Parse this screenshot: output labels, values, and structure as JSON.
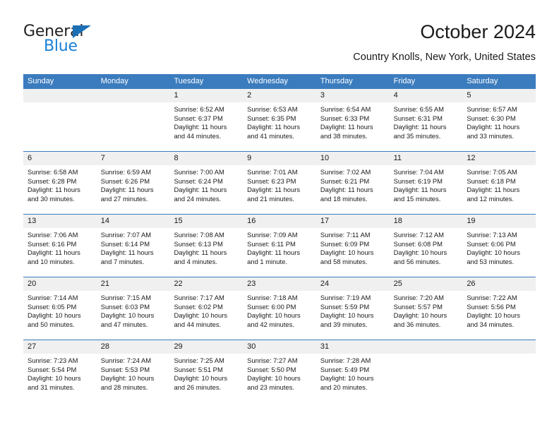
{
  "brand": {
    "name_part1": "General",
    "name_part2": "Blue",
    "accent_color": "#1a7fd4",
    "triangle_color": "#1a6fb5"
  },
  "header": {
    "title": "October 2024",
    "subtitle": "Country Knolls, New York, United States"
  },
  "calendar": {
    "header_bg": "#3b7cbe",
    "weekdays": [
      "Sunday",
      "Monday",
      "Tuesday",
      "Wednesday",
      "Thursday",
      "Friday",
      "Saturday"
    ],
    "weeks": [
      [
        {
          "day": "",
          "sunrise": "",
          "sunset": "",
          "daylight_line1": "",
          "daylight_line2": ""
        },
        {
          "day": "",
          "sunrise": "",
          "sunset": "",
          "daylight_line1": "",
          "daylight_line2": ""
        },
        {
          "day": "1",
          "sunrise": "Sunrise: 6:52 AM",
          "sunset": "Sunset: 6:37 PM",
          "daylight_line1": "Daylight: 11 hours",
          "daylight_line2": "and 44 minutes."
        },
        {
          "day": "2",
          "sunrise": "Sunrise: 6:53 AM",
          "sunset": "Sunset: 6:35 PM",
          "daylight_line1": "Daylight: 11 hours",
          "daylight_line2": "and 41 minutes."
        },
        {
          "day": "3",
          "sunrise": "Sunrise: 6:54 AM",
          "sunset": "Sunset: 6:33 PM",
          "daylight_line1": "Daylight: 11 hours",
          "daylight_line2": "and 38 minutes."
        },
        {
          "day": "4",
          "sunrise": "Sunrise: 6:55 AM",
          "sunset": "Sunset: 6:31 PM",
          "daylight_line1": "Daylight: 11 hours",
          "daylight_line2": "and 35 minutes."
        },
        {
          "day": "5",
          "sunrise": "Sunrise: 6:57 AM",
          "sunset": "Sunset: 6:30 PM",
          "daylight_line1": "Daylight: 11 hours",
          "daylight_line2": "and 33 minutes."
        }
      ],
      [
        {
          "day": "6",
          "sunrise": "Sunrise: 6:58 AM",
          "sunset": "Sunset: 6:28 PM",
          "daylight_line1": "Daylight: 11 hours",
          "daylight_line2": "and 30 minutes."
        },
        {
          "day": "7",
          "sunrise": "Sunrise: 6:59 AM",
          "sunset": "Sunset: 6:26 PM",
          "daylight_line1": "Daylight: 11 hours",
          "daylight_line2": "and 27 minutes."
        },
        {
          "day": "8",
          "sunrise": "Sunrise: 7:00 AM",
          "sunset": "Sunset: 6:24 PM",
          "daylight_line1": "Daylight: 11 hours",
          "daylight_line2": "and 24 minutes."
        },
        {
          "day": "9",
          "sunrise": "Sunrise: 7:01 AM",
          "sunset": "Sunset: 6:23 PM",
          "daylight_line1": "Daylight: 11 hours",
          "daylight_line2": "and 21 minutes."
        },
        {
          "day": "10",
          "sunrise": "Sunrise: 7:02 AM",
          "sunset": "Sunset: 6:21 PM",
          "daylight_line1": "Daylight: 11 hours",
          "daylight_line2": "and 18 minutes."
        },
        {
          "day": "11",
          "sunrise": "Sunrise: 7:04 AM",
          "sunset": "Sunset: 6:19 PM",
          "daylight_line1": "Daylight: 11 hours",
          "daylight_line2": "and 15 minutes."
        },
        {
          "day": "12",
          "sunrise": "Sunrise: 7:05 AM",
          "sunset": "Sunset: 6:18 PM",
          "daylight_line1": "Daylight: 11 hours",
          "daylight_line2": "and 12 minutes."
        }
      ],
      [
        {
          "day": "13",
          "sunrise": "Sunrise: 7:06 AM",
          "sunset": "Sunset: 6:16 PM",
          "daylight_line1": "Daylight: 11 hours",
          "daylight_line2": "and 10 minutes."
        },
        {
          "day": "14",
          "sunrise": "Sunrise: 7:07 AM",
          "sunset": "Sunset: 6:14 PM",
          "daylight_line1": "Daylight: 11 hours",
          "daylight_line2": "and 7 minutes."
        },
        {
          "day": "15",
          "sunrise": "Sunrise: 7:08 AM",
          "sunset": "Sunset: 6:13 PM",
          "daylight_line1": "Daylight: 11 hours",
          "daylight_line2": "and 4 minutes."
        },
        {
          "day": "16",
          "sunrise": "Sunrise: 7:09 AM",
          "sunset": "Sunset: 6:11 PM",
          "daylight_line1": "Daylight: 11 hours",
          "daylight_line2": "and 1 minute."
        },
        {
          "day": "17",
          "sunrise": "Sunrise: 7:11 AM",
          "sunset": "Sunset: 6:09 PM",
          "daylight_line1": "Daylight: 10 hours",
          "daylight_line2": "and 58 minutes."
        },
        {
          "day": "18",
          "sunrise": "Sunrise: 7:12 AM",
          "sunset": "Sunset: 6:08 PM",
          "daylight_line1": "Daylight: 10 hours",
          "daylight_line2": "and 56 minutes."
        },
        {
          "day": "19",
          "sunrise": "Sunrise: 7:13 AM",
          "sunset": "Sunset: 6:06 PM",
          "daylight_line1": "Daylight: 10 hours",
          "daylight_line2": "and 53 minutes."
        }
      ],
      [
        {
          "day": "20",
          "sunrise": "Sunrise: 7:14 AM",
          "sunset": "Sunset: 6:05 PM",
          "daylight_line1": "Daylight: 10 hours",
          "daylight_line2": "and 50 minutes."
        },
        {
          "day": "21",
          "sunrise": "Sunrise: 7:15 AM",
          "sunset": "Sunset: 6:03 PM",
          "daylight_line1": "Daylight: 10 hours",
          "daylight_line2": "and 47 minutes."
        },
        {
          "day": "22",
          "sunrise": "Sunrise: 7:17 AM",
          "sunset": "Sunset: 6:02 PM",
          "daylight_line1": "Daylight: 10 hours",
          "daylight_line2": "and 44 minutes."
        },
        {
          "day": "23",
          "sunrise": "Sunrise: 7:18 AM",
          "sunset": "Sunset: 6:00 PM",
          "daylight_line1": "Daylight: 10 hours",
          "daylight_line2": "and 42 minutes."
        },
        {
          "day": "24",
          "sunrise": "Sunrise: 7:19 AM",
          "sunset": "Sunset: 5:59 PM",
          "daylight_line1": "Daylight: 10 hours",
          "daylight_line2": "and 39 minutes."
        },
        {
          "day": "25",
          "sunrise": "Sunrise: 7:20 AM",
          "sunset": "Sunset: 5:57 PM",
          "daylight_line1": "Daylight: 10 hours",
          "daylight_line2": "and 36 minutes."
        },
        {
          "day": "26",
          "sunrise": "Sunrise: 7:22 AM",
          "sunset": "Sunset: 5:56 PM",
          "daylight_line1": "Daylight: 10 hours",
          "daylight_line2": "and 34 minutes."
        }
      ],
      [
        {
          "day": "27",
          "sunrise": "Sunrise: 7:23 AM",
          "sunset": "Sunset: 5:54 PM",
          "daylight_line1": "Daylight: 10 hours",
          "daylight_line2": "and 31 minutes."
        },
        {
          "day": "28",
          "sunrise": "Sunrise: 7:24 AM",
          "sunset": "Sunset: 5:53 PM",
          "daylight_line1": "Daylight: 10 hours",
          "daylight_line2": "and 28 minutes."
        },
        {
          "day": "29",
          "sunrise": "Sunrise: 7:25 AM",
          "sunset": "Sunset: 5:51 PM",
          "daylight_line1": "Daylight: 10 hours",
          "daylight_line2": "and 26 minutes."
        },
        {
          "day": "30",
          "sunrise": "Sunrise: 7:27 AM",
          "sunset": "Sunset: 5:50 PM",
          "daylight_line1": "Daylight: 10 hours",
          "daylight_line2": "and 23 minutes."
        },
        {
          "day": "31",
          "sunrise": "Sunrise: 7:28 AM",
          "sunset": "Sunset: 5:49 PM",
          "daylight_line1": "Daylight: 10 hours",
          "daylight_line2": "and 20 minutes."
        },
        {
          "day": "",
          "sunrise": "",
          "sunset": "",
          "daylight_line1": "",
          "daylight_line2": ""
        },
        {
          "day": "",
          "sunrise": "",
          "sunset": "",
          "daylight_line1": "",
          "daylight_line2": ""
        }
      ]
    ]
  }
}
